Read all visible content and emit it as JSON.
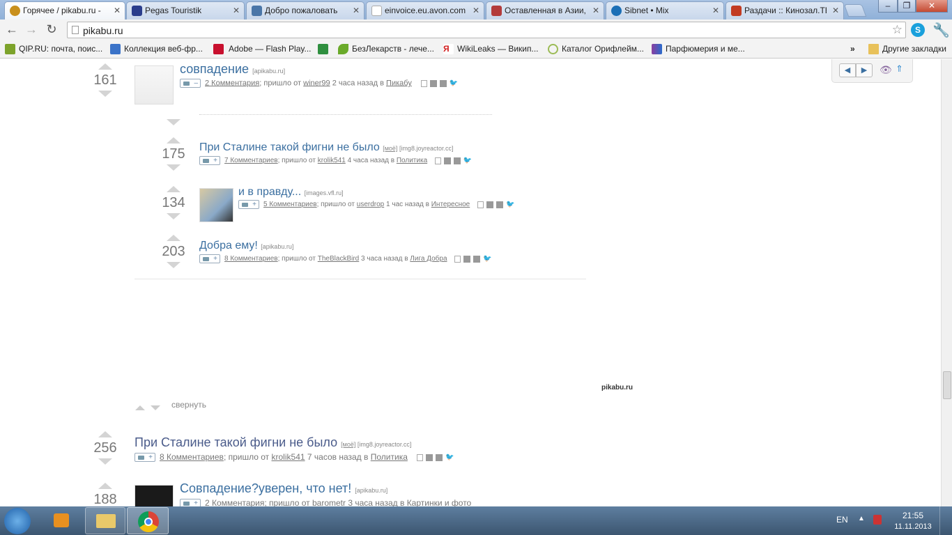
{
  "tabs": [
    {
      "label": "Горячее / pikabu.ru -",
      "active": true,
      "color": "#c8901e"
    },
    {
      "label": "Pegas Touristik",
      "active": false,
      "color": "#2a3d8c"
    },
    {
      "label": "Добро пожаловать",
      "active": false,
      "color": "#4a76a8"
    },
    {
      "label": "einvoice.eu.avon.com",
      "active": false,
      "color": "#dddddd"
    },
    {
      "label": "Оставленная в Азии,",
      "active": false,
      "color": "#b33b3b"
    },
    {
      "label": "Sibnet • Mix",
      "active": false,
      "color": "#1b6fb6"
    },
    {
      "label": "Раздачи :: Кинозал.ТВ",
      "active": false,
      "color": "#c23b22"
    }
  ],
  "address": {
    "url": "pikabu.ru"
  },
  "bookmarks": [
    {
      "label": "QIP.RU: почта, поис...",
      "color": "#7da32b"
    },
    {
      "label": "Коллекция веб-фр...",
      "color": "#3b73c8"
    },
    {
      "label": "Adobe — Flash Play...",
      "color": "#c8102e"
    },
    {
      "label": "",
      "color": "#2f8f3f"
    },
    {
      "label": "БезЛекарств - лече...",
      "color": "#6aaa2a"
    },
    {
      "label": "WikiLeaks — Викип...",
      "color": "#d12020"
    },
    {
      "label": "Каталог Орифлейм...",
      "color": "#9bbb55"
    },
    {
      "label": "Парфюмерия и ме...",
      "color": "#8b3fa0"
    }
  ],
  "bookmarks_other": "Другие закладки",
  "bookmarks_more": "»",
  "posts": [
    {
      "score": "161",
      "title": "совпадение",
      "source": "[apikabu.ru]",
      "comments": "2 Комментария",
      "from": "; пришло от",
      "author": "winer99",
      "time": "2 часа назад в",
      "section": "Пикабу",
      "cam": "–"
    },
    {
      "score": "175",
      "title": "При Сталине такой фигни не было",
      "tag": "[моё]",
      "source": "[img8.joyreactor.cc]",
      "comments": "7 Комментариев",
      "from": "; пришло от",
      "author": "krolik541",
      "time": "4 часа назад в",
      "section": "Политика",
      "cam": "+"
    },
    {
      "score": "134",
      "title": "и в правду...",
      "source": "[images.vfl.ru]",
      "comments": "5 Комментариев",
      "from": "; пришло от",
      "author": "userdrop",
      "time": "1 час назад в",
      "section": "Интересное",
      "cam": "+"
    },
    {
      "score": "203",
      "title": "Добра ему!",
      "source": "[apikabu.ru]",
      "comments": "8 Комментариев",
      "from": "; пришло от",
      "author": "TheBlackBird",
      "time": "3 часа назад в",
      "section": "Лига Добра",
      "cam": "+"
    },
    {
      "score": "256",
      "title": "При Сталине такой фигни не было",
      "tag": "[моё]",
      "source": "[img8.joyreactor.cc]",
      "comments": "8 Комментариев",
      "from": "; пришло от",
      "author": "krolik541",
      "time": "7 часов назад в",
      "section": "Политика",
      "cam": "+"
    },
    {
      "score": "188",
      "title": "Совпадение?уверен, что нет!",
      "source": "[apikabu.ru]",
      "comments": "2 Комментария",
      "from": "; пришло от",
      "author": "barometr",
      "time": "3 часа назад в",
      "section": "Картинки и фото",
      "cam": "+"
    }
  ],
  "collapse_label": "свернуть",
  "watermark": "pikabu.ru",
  "taskbar": {
    "lang": "EN",
    "time": "21:55",
    "date": "11.11.2013"
  }
}
